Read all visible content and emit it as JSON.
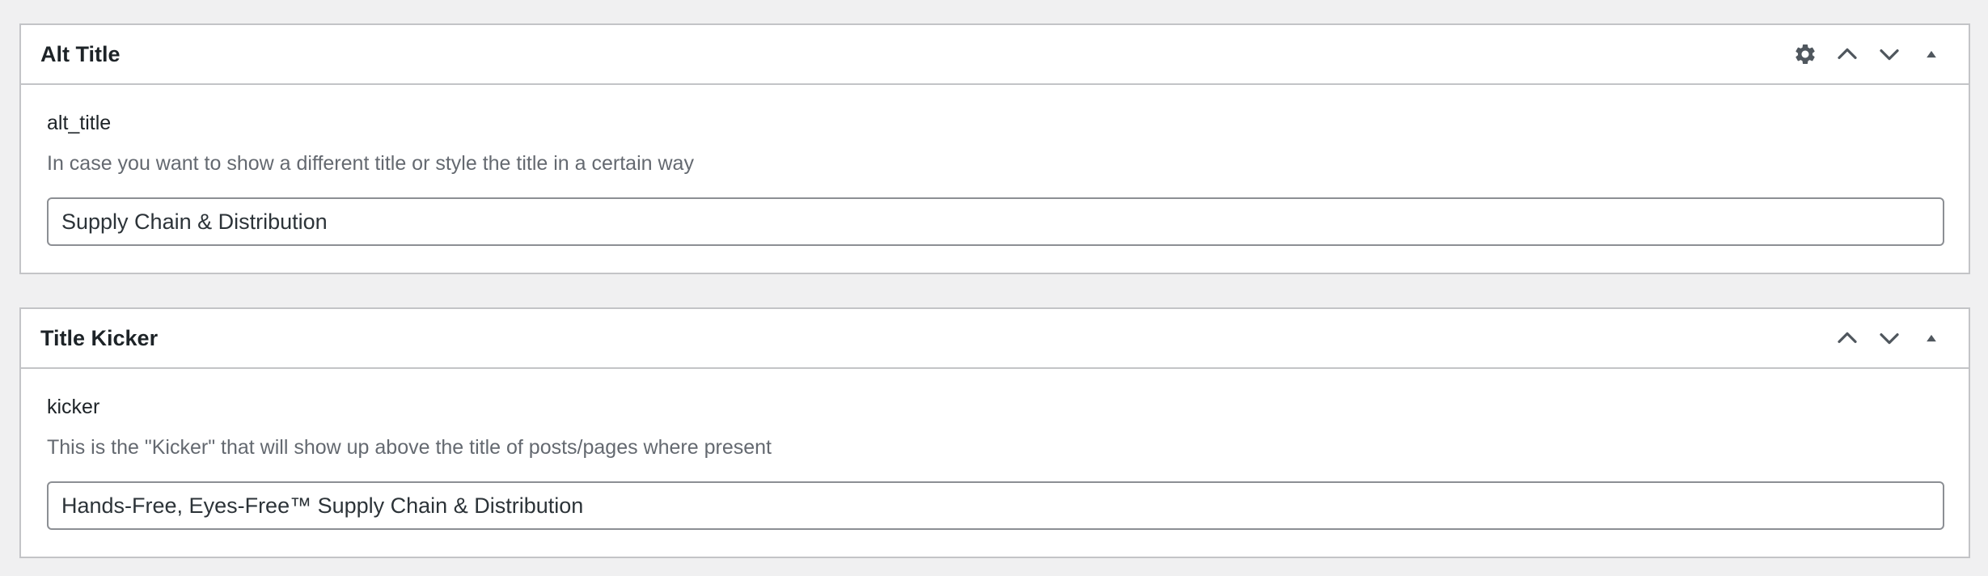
{
  "boxes": [
    {
      "title": "Alt Title",
      "field_label": "alt_title",
      "field_description": "In case you want to show a different title or style the title in a certain way",
      "field_value": "Supply Chain & Distribution",
      "actions": [
        "gear-icon",
        "move-up-icon",
        "move-down-icon",
        "toggle-arrow-icon"
      ]
    },
    {
      "title": "Title Kicker",
      "field_label": "kicker",
      "field_description": "This is the \"Kicker\" that will show up above the title of posts/pages where present",
      "field_value": "Hands-Free, Eyes-Free™ Supply Chain & Distribution",
      "actions": [
        "move-up-icon",
        "move-down-icon",
        "toggle-arrow-icon"
      ]
    }
  ],
  "colors": {
    "page_background": "#f0f0f1",
    "border": "#c3c4c7",
    "description_text": "#646970",
    "icon": "#50575e"
  }
}
